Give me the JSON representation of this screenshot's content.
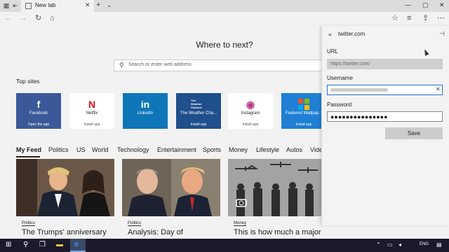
{
  "browser": {
    "tab_title": "New tab",
    "tab_close_icon": "close-icon",
    "new_tab_symbol": "+",
    "tab_list_symbol": "⌄",
    "window_controls": [
      "—",
      "▢",
      "✕"
    ]
  },
  "nav": {
    "back": "←",
    "forward": "→",
    "refresh": "↻",
    "home": "⌂",
    "favorites": "☆",
    "reading": "≡",
    "share": "⇪",
    "more": "⋯"
  },
  "page": {
    "heading": "Where to next?",
    "search_placeholder": "Search or enter web address",
    "top_sites_label": "Top sites",
    "top_sites": [
      {
        "name": "Facebook",
        "sub": "Open the app",
        "icon": "f",
        "bg": "#3b5998",
        "fg": "#ffffff"
      },
      {
        "name": "Netflix",
        "sub": "Install app",
        "icon": "N",
        "bg": "#ffffff",
        "fg": "#e50914"
      },
      {
        "name": "LinkedIn",
        "sub": "",
        "icon": "in",
        "bg": "#0e76b8",
        "fg": "#ffffff"
      },
      {
        "name": "The Weather Cha...",
        "sub": "Install app",
        "icon": "The Weather Channel",
        "bg": "#1f4f8c",
        "fg": "#ffffff"
      },
      {
        "name": "Instagram",
        "sub": "Install app",
        "icon": "◉",
        "bg": "#ffffff",
        "fg": "#c13584"
      },
      {
        "name": "Featured Wallpap...",
        "sub": "Install app",
        "icon": "⊞",
        "bg": "#1e7fd4",
        "fg": "#ffffff"
      }
    ],
    "feed_tabs": [
      "My Feed",
      "Politics",
      "US",
      "World",
      "Technology",
      "Entertainment",
      "Sports",
      "Money",
      "Lifestyle",
      "Autos",
      "Vide"
    ],
    "news": [
      {
        "category": "Politics",
        "title": "The Trumps' anniversary"
      },
      {
        "category": "Politics",
        "title": "Analysis: Day of"
      },
      {
        "category": "Money",
        "title": "This is how much a major"
      }
    ]
  },
  "panel": {
    "back_icon": "«",
    "site": "twitter.com",
    "pin_icon": "⊣",
    "url_label": "URL",
    "url_value": "https://twitter.com/",
    "username_label": "Username",
    "username_value": "",
    "password_label": "Password",
    "password_value": "●●●●●●●●●●●●●●●",
    "save_label": "Save"
  },
  "taskbar": {
    "start": "⊞",
    "search": "⚲",
    "taskview": "❐",
    "explorer": "▬",
    "edge": "e",
    "language": "ENG"
  },
  "colors": {
    "accent": "#2b6cd6",
    "taskbar": "#1a1a2b"
  }
}
